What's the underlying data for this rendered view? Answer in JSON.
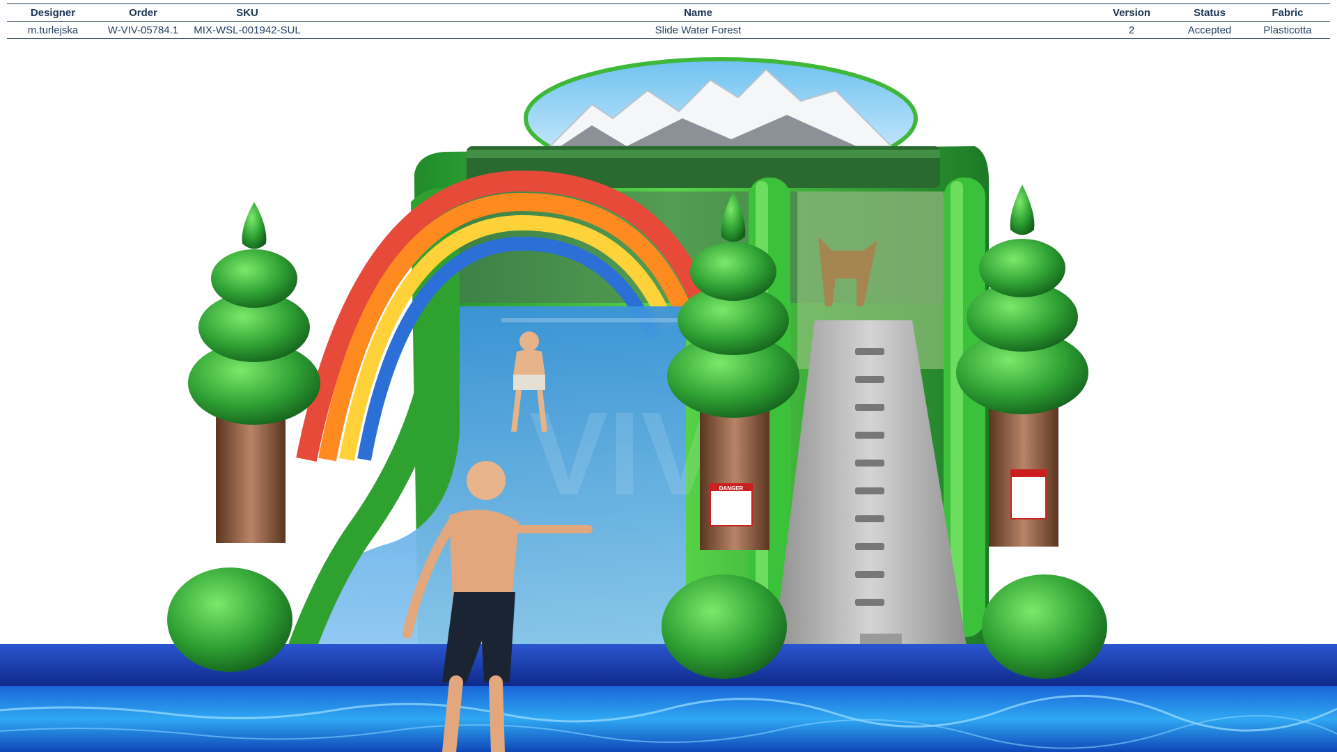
{
  "info_table": {
    "headers": {
      "designer": "Designer",
      "order": "Order",
      "sku": "SKU",
      "name": "Name",
      "version": "Version",
      "status": "Status",
      "fabric": "Fabric"
    },
    "row": {
      "designer": "m.turlejska",
      "order": "W-VIV-05784.1",
      "sku": "MIX-WSL-001942-SUL",
      "name": "Slide Water Forest",
      "version": "2",
      "status": "Accepted",
      "fabric": "Plasticotta"
    }
  },
  "render": {
    "watermark": "VIV",
    "warning_label": "DANGER",
    "colors": {
      "sky": "#dff3ff",
      "forest_green": "#3fb83a",
      "dark_green": "#1d7a26",
      "trunk": "#8a5a3a",
      "pool_blue": "#1b3fae",
      "water": "#2f8fe8",
      "slide_blue": "#4aa4e6",
      "stair_grey": "#b8b8b8"
    }
  }
}
